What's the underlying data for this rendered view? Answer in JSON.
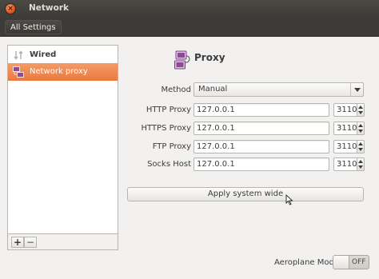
{
  "window": {
    "title": "Network",
    "close_glyph": "×"
  },
  "toolbar": {
    "all_settings_label": "All Settings"
  },
  "sidebar": {
    "items": [
      {
        "label": "Wired",
        "icon": "wired-arrows-icon",
        "selected": false
      },
      {
        "label": "Network proxy",
        "icon": "network-proxy-icon",
        "selected": true
      }
    ],
    "add_label": "+",
    "remove_label": "−"
  },
  "proxy": {
    "title": "Proxy",
    "method_label": "Method",
    "method_value": "Manual",
    "rows": [
      {
        "label": "HTTP Proxy",
        "host": "127.0.0.1",
        "port": "3110"
      },
      {
        "label": "HTTPS Proxy",
        "host": "127.0.0.1",
        "port": "3110"
      },
      {
        "label": "FTP Proxy",
        "host": "127.0.0.1",
        "port": "3110"
      },
      {
        "label": "Socks Host",
        "host": "127.0.0.1",
        "port": "3110"
      }
    ],
    "apply_label": "Apply system wide"
  },
  "footer": {
    "aeroplane_label": "Aeroplane Mode",
    "aeroplane_state": "OFF"
  },
  "colors": {
    "accent": "#ea7a3c",
    "titlebar": "#3c3b37",
    "close_button": "#e2561e"
  }
}
